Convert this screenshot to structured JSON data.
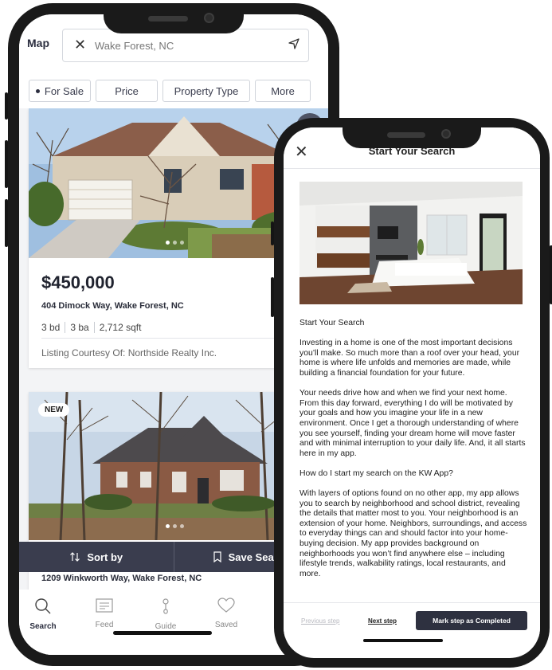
{
  "map_screen": {
    "header": {
      "map_label": "Map",
      "search_value": "Wake Forest, NC"
    },
    "filters": [
      "For Sale",
      "Price",
      "Property Type",
      "More"
    ],
    "listings": [
      {
        "price": "$450,000",
        "address": "404 Dimock Way, Wake Forest, NC",
        "beds": "3 bd",
        "baths": "3 ba",
        "sqft": "2,712 sqft",
        "courtesy": "Listing Courtesy Of: Northside Realty Inc."
      },
      {
        "badge": "NEW",
        "address": "1209 Winkworth Way, Wake Forest, NC"
      }
    ],
    "actions": {
      "sort_label": "Sort by",
      "save_label": "Save Search"
    },
    "tabs": [
      "Search",
      "Feed",
      "Guide",
      "Saved"
    ],
    "active_tab": "Search"
  },
  "guide_screen": {
    "title": "Start Your Search",
    "heading": "Start Your Search",
    "paragraphs": [
      "Investing in a home is one of the most important decisions you’ll make. So much more than a roof over your head, your home is where life unfolds and memories are made, while building a financial foundation for your future.",
      "Your needs drive how and when we find your next home. From this day forward, everything I do will be motivated by your goals and how you imagine your life in a new environment. Once I get a thorough understanding of where you see yourself, finding your dream home will move faster and with minimal interruption to your daily life. And, it all starts here in my app.",
      "How do I start my search on the KW App?",
      "With layers of options found on no other app, my app allows you to search by neighborhood and school district, revealing the details that matter most to you. Your neighborhood is an extension of your home. Neighbors, surroundings, and access to everyday things can and should factor into your home-buying decision. My app provides background on neighborhoods you won’t find anywhere else – including lifestyle trends, walkability ratings, local restaurants, and more."
    ],
    "footer": {
      "previous": "Previous step",
      "next": "Next step",
      "complete": "Mark step as Completed"
    }
  },
  "colors": {
    "dark_navy": "#2e3140",
    "action_bar": "#3a3d4e",
    "phone_frame": "#1a1a1a"
  }
}
